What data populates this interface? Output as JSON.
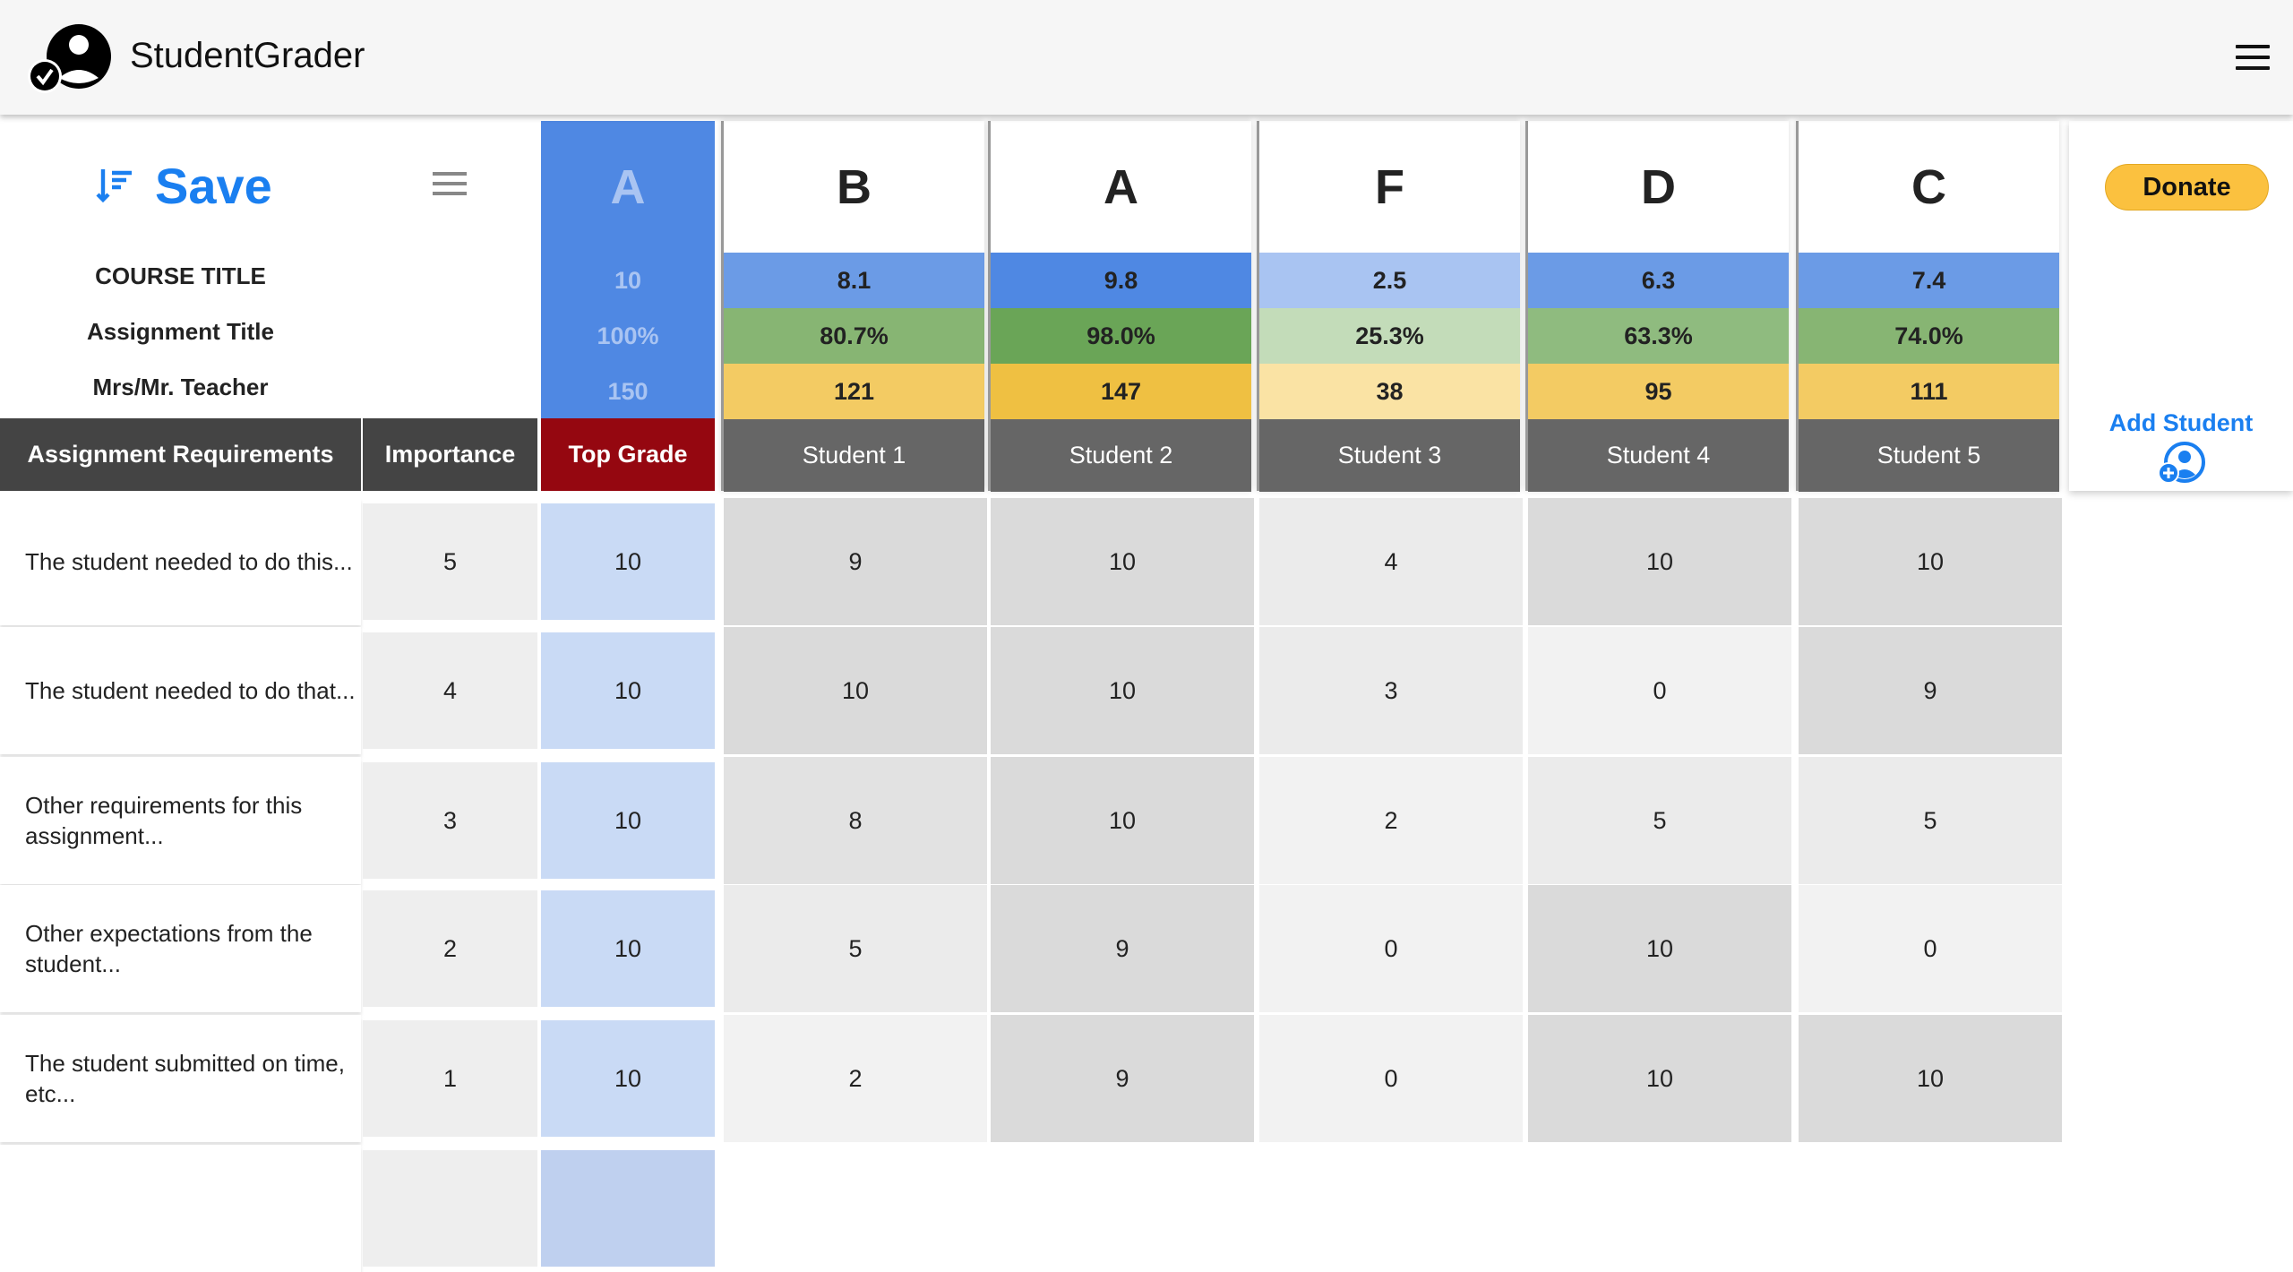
{
  "app": {
    "title": "StudentGrader"
  },
  "toolbar": {
    "save_label": "Save"
  },
  "meta": {
    "course_title": "COURSE TITLE",
    "assignment_title": "Assignment Title",
    "teacher": "Mrs/Mr. Teacher"
  },
  "top_grade": {
    "letter": "A",
    "score": "10",
    "percent": "100%",
    "points": "150"
  },
  "headers": {
    "requirements": "Assignment Requirements",
    "importance": "Importance",
    "top_grade": "Top Grade"
  },
  "colors": {
    "accent": "#1a7ff0",
    "top_grade_header": "#950710",
    "top_col": "#4f88e3",
    "header_dark": "#444444",
    "student_header": "#666666"
  },
  "students": [
    {
      "name": "Student 1",
      "letter": "B",
      "score": "8.1",
      "percent": "80.7%",
      "points": "121",
      "blue": "#6b9be6",
      "green": "#87b573",
      "yellow": "#f3cb63"
    },
    {
      "name": "Student 2",
      "letter": "A",
      "score": "9.8",
      "percent": "98.0%",
      "points": "147",
      "blue": "#4f88e3",
      "green": "#6aa557",
      "yellow": "#efc042"
    },
    {
      "name": "Student 3",
      "letter": "F",
      "score": "2.5",
      "percent": "25.3%",
      "points": "38",
      "blue": "#a9c4f2",
      "green": "#c3dcb9",
      "yellow": "#fae3a4"
    },
    {
      "name": "Student 4",
      "letter": "D",
      "score": "6.3",
      "percent": "63.3%",
      "points": "95",
      "blue": "#6b9be6",
      "green": "#8fbb7f",
      "yellow": "#f3cb63"
    },
    {
      "name": "Student 5",
      "letter": "C",
      "score": "7.4",
      "percent": "74.0%",
      "points": "111",
      "blue": "#6b9be6",
      "green": "#87b573",
      "yellow": "#f3cb63"
    }
  ],
  "add_column": {
    "donate": "Donate",
    "add_student": "Add Student"
  },
  "rows": [
    {
      "requirement": "The student needed to do this...",
      "importance": "5",
      "top": "10",
      "scores": [
        "9",
        "10",
        "4",
        "10",
        "10"
      ]
    },
    {
      "requirement": "The student needed to do that...",
      "importance": "4",
      "top": "10",
      "scores": [
        "10",
        "10",
        "3",
        "0",
        "9"
      ]
    },
    {
      "requirement": "Other requirements for this assignment...",
      "importance": "3",
      "top": "10",
      "scores": [
        "8",
        "10",
        "2",
        "5",
        "5"
      ]
    },
    {
      "requirement": "Other expectations from the student...",
      "importance": "2",
      "top": "10",
      "scores": [
        "5",
        "9",
        "0",
        "10",
        "0"
      ]
    },
    {
      "requirement": "The student submitted on time, etc...",
      "importance": "1",
      "top": "10",
      "scores": [
        "2",
        "9",
        "0",
        "10",
        "10"
      ]
    }
  ]
}
